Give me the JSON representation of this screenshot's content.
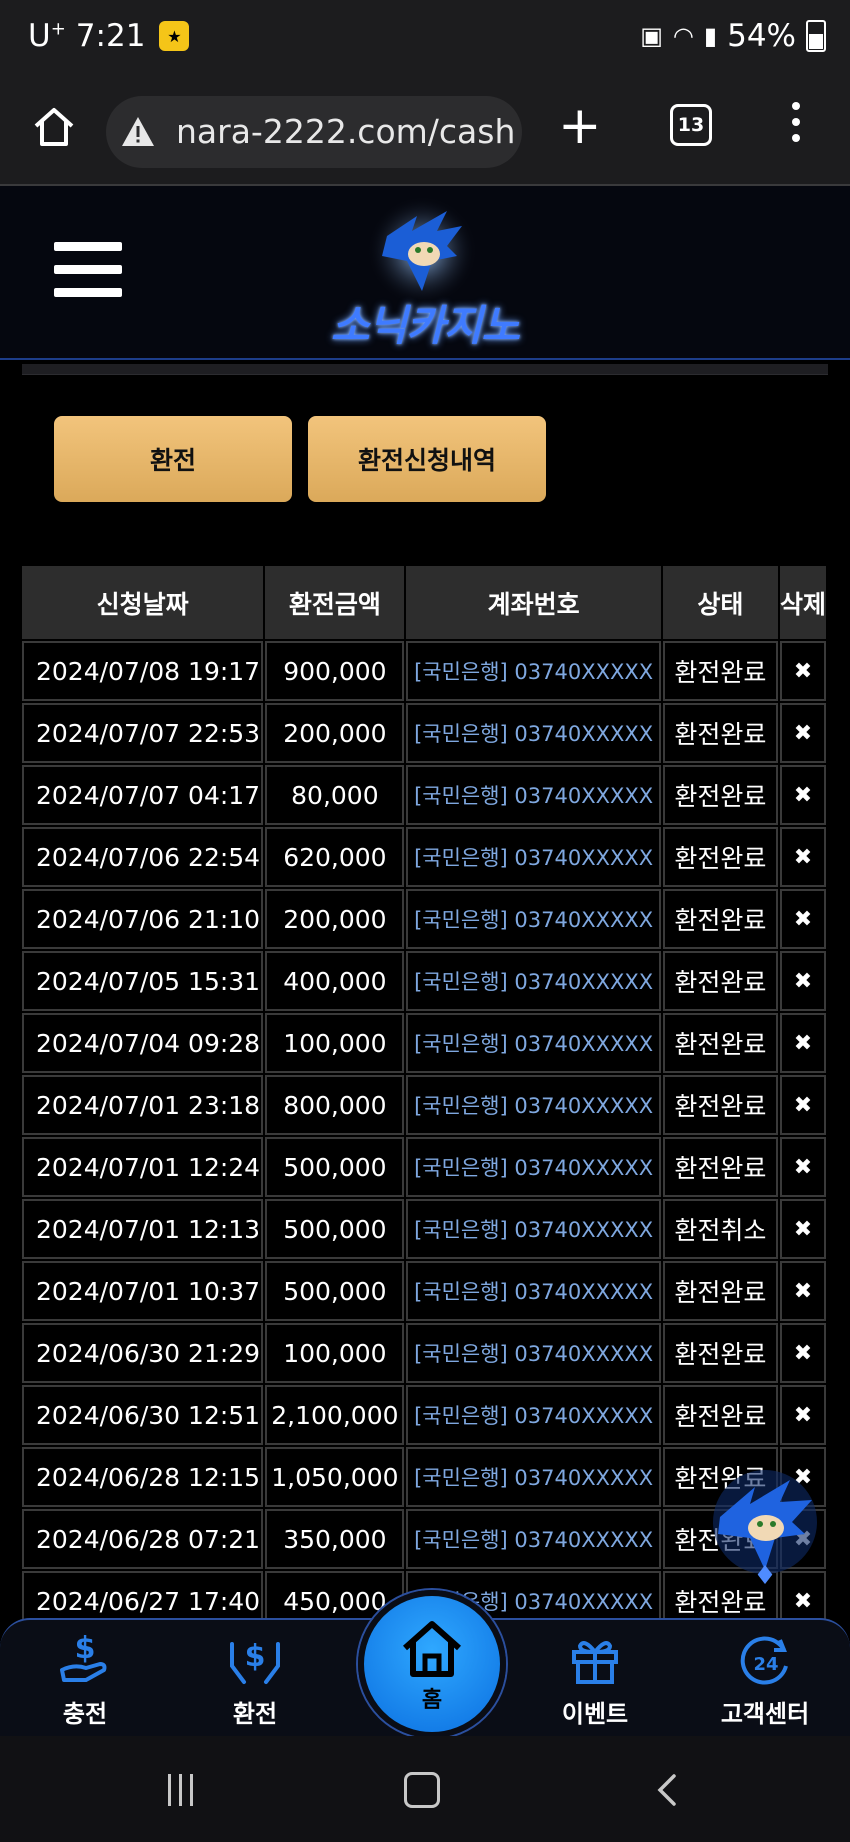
{
  "status_bar": {
    "carrier": "U",
    "carrier_sup": "+",
    "time": "7:21",
    "battery": "54%"
  },
  "browser": {
    "url": "nara-2222.com/cash",
    "tab_count": "13"
  },
  "site": {
    "logo_text": "소닉카지노"
  },
  "actions": {
    "exchange": "환전",
    "history": "환전신청내역"
  },
  "table": {
    "headers": [
      "신청날짜",
      "환전금액",
      "계좌번호",
      "상태",
      "삭제"
    ],
    "rows": [
      {
        "date": "2024/07/08 19:17",
        "amount": "900,000",
        "account": "[국민은행] 03740XXXXX",
        "status": "환전완료"
      },
      {
        "date": "2024/07/07 22:53",
        "amount": "200,000",
        "account": "[국민은행] 03740XXXXX",
        "status": "환전완료"
      },
      {
        "date": "2024/07/07 04:17",
        "amount": "80,000",
        "account": "[국민은행] 03740XXXXX",
        "status": "환전완료"
      },
      {
        "date": "2024/07/06 22:54",
        "amount": "620,000",
        "account": "[국민은행] 03740XXXXX",
        "status": "환전완료"
      },
      {
        "date": "2024/07/06 21:10",
        "amount": "200,000",
        "account": "[국민은행] 03740XXXXX",
        "status": "환전완료"
      },
      {
        "date": "2024/07/05 15:31",
        "amount": "400,000",
        "account": "[국민은행] 03740XXXXX",
        "status": "환전완료"
      },
      {
        "date": "2024/07/04 09:28",
        "amount": "100,000",
        "account": "[국민은행] 03740XXXXX",
        "status": "환전완료"
      },
      {
        "date": "2024/07/01 23:18",
        "amount": "800,000",
        "account": "[국민은행] 03740XXXXX",
        "status": "환전완료"
      },
      {
        "date": "2024/07/01 12:24",
        "amount": "500,000",
        "account": "[국민은행] 03740XXXXX",
        "status": "환전완료"
      },
      {
        "date": "2024/07/01 12:13",
        "amount": "500,000",
        "account": "[국민은행] 03740XXXXX",
        "status": "환전취소"
      },
      {
        "date": "2024/07/01 10:37",
        "amount": "500,000",
        "account": "[국민은행] 03740XXXXX",
        "status": "환전완료"
      },
      {
        "date": "2024/06/30 21:29",
        "amount": "100,000",
        "account": "[국민은행] 03740XXXXX",
        "status": "환전완료"
      },
      {
        "date": "2024/06/30 12:51",
        "amount": "2,100,000",
        "account": "[국민은행] 03740XXXXX",
        "status": "환전완료"
      },
      {
        "date": "2024/06/28 12:15",
        "amount": "1,050,000",
        "account": "[국민은행] 03740XXXXX",
        "status": "환전완료"
      },
      {
        "date": "2024/06/28 07:21",
        "amount": "350,000",
        "account": "[국민은행] 03740XXXXX",
        "status": "환전완료"
      },
      {
        "date": "2024/06/27 17:40",
        "amount": "450,000",
        "account": "[국민은행] 03740XXXXX",
        "status": "환전완료"
      }
    ],
    "delete_symbol": "✖"
  },
  "bottom_nav": {
    "charge": "충전",
    "exchange": "환전",
    "home": "홈",
    "event": "이벤트",
    "support": "고객센터",
    "support_badge": "24"
  },
  "colors": {
    "accent_gold": "#e8b86a",
    "link_blue": "#7fa8e0",
    "nav_blue": "#1e88e5"
  }
}
